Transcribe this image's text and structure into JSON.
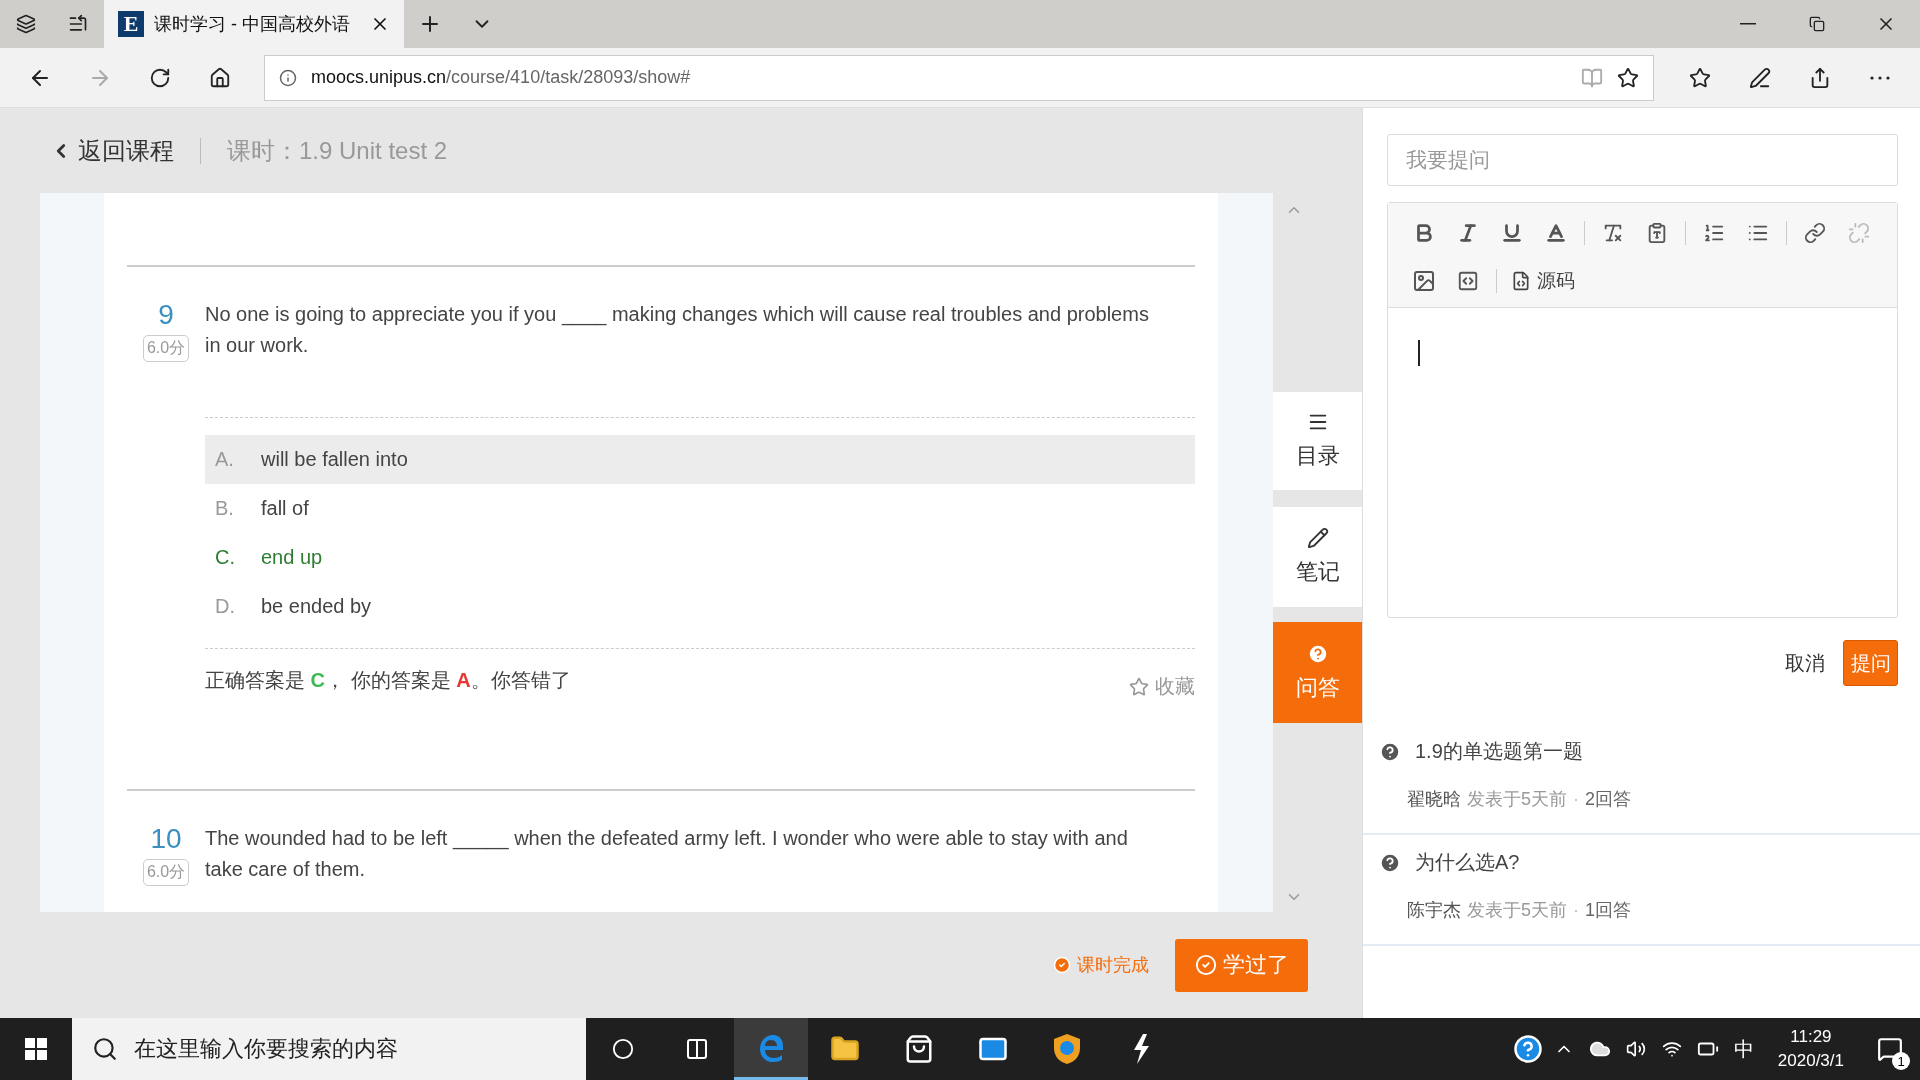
{
  "browser": {
    "tab_icon_letter": "E",
    "tab_title": "课时学习 - 中国高校外语",
    "address_domain": "moocs.unipus.cn",
    "address_path": "/course/410/task/28093/show#"
  },
  "header": {
    "back_link": "返回课程",
    "lesson_title": "课时：1.9 Unit test 2"
  },
  "questions": [
    {
      "number": "9",
      "score": "6.0分",
      "text": "No one is going to appreciate you if you ____ making changes which will cause real troubles and problems in our work.",
      "options": [
        {
          "letter": "A.",
          "text": "will be fallen into",
          "selected": true,
          "correct": false
        },
        {
          "letter": "B.",
          "text": "fall of",
          "selected": false,
          "correct": false
        },
        {
          "letter": "C.",
          "text": "end up",
          "selected": false,
          "correct": true
        },
        {
          "letter": "D.",
          "text": "be ended by",
          "selected": false,
          "correct": false
        }
      ],
      "feedback": {
        "prefix": "正确答案是 ",
        "correct_letter": "C",
        "middle": "， 你的答案是 ",
        "your_letter": "A",
        "suffix": "。你答错了"
      },
      "favorite": "收藏"
    },
    {
      "number": "10",
      "score": "6.0分",
      "text": "The wounded had to be left _____ when the defeated army left. I wonder who were able to stay with and take care of them."
    }
  ],
  "side_nav": [
    {
      "kind": "contents",
      "label": "目录",
      "selected": false
    },
    {
      "kind": "notes",
      "label": "笔记",
      "selected": false
    },
    {
      "kind": "qa",
      "label": "问答",
      "selected": true
    }
  ],
  "footer": {
    "status": "课时完成",
    "done_button": "学过了"
  },
  "ask_panel": {
    "title_placeholder": "我要提问",
    "source_button": "源码",
    "cancel": "取消",
    "submit": "提问",
    "questions": [
      {
        "title": "1.9的单选题第一题",
        "author": "翟晓晗",
        "posted": "发表于5天前",
        "separator": "·",
        "answers": "2回答"
      },
      {
        "title": "为什么选A?",
        "author": "陈宇杰",
        "posted": "发表于5天前",
        "separator": "·",
        "answers": "1回答"
      }
    ]
  },
  "taskbar": {
    "search_placeholder": "在这里输入你要搜索的内容",
    "ime": "中",
    "time": "11:29",
    "date": "2020/3/1",
    "notifications": "1"
  }
}
